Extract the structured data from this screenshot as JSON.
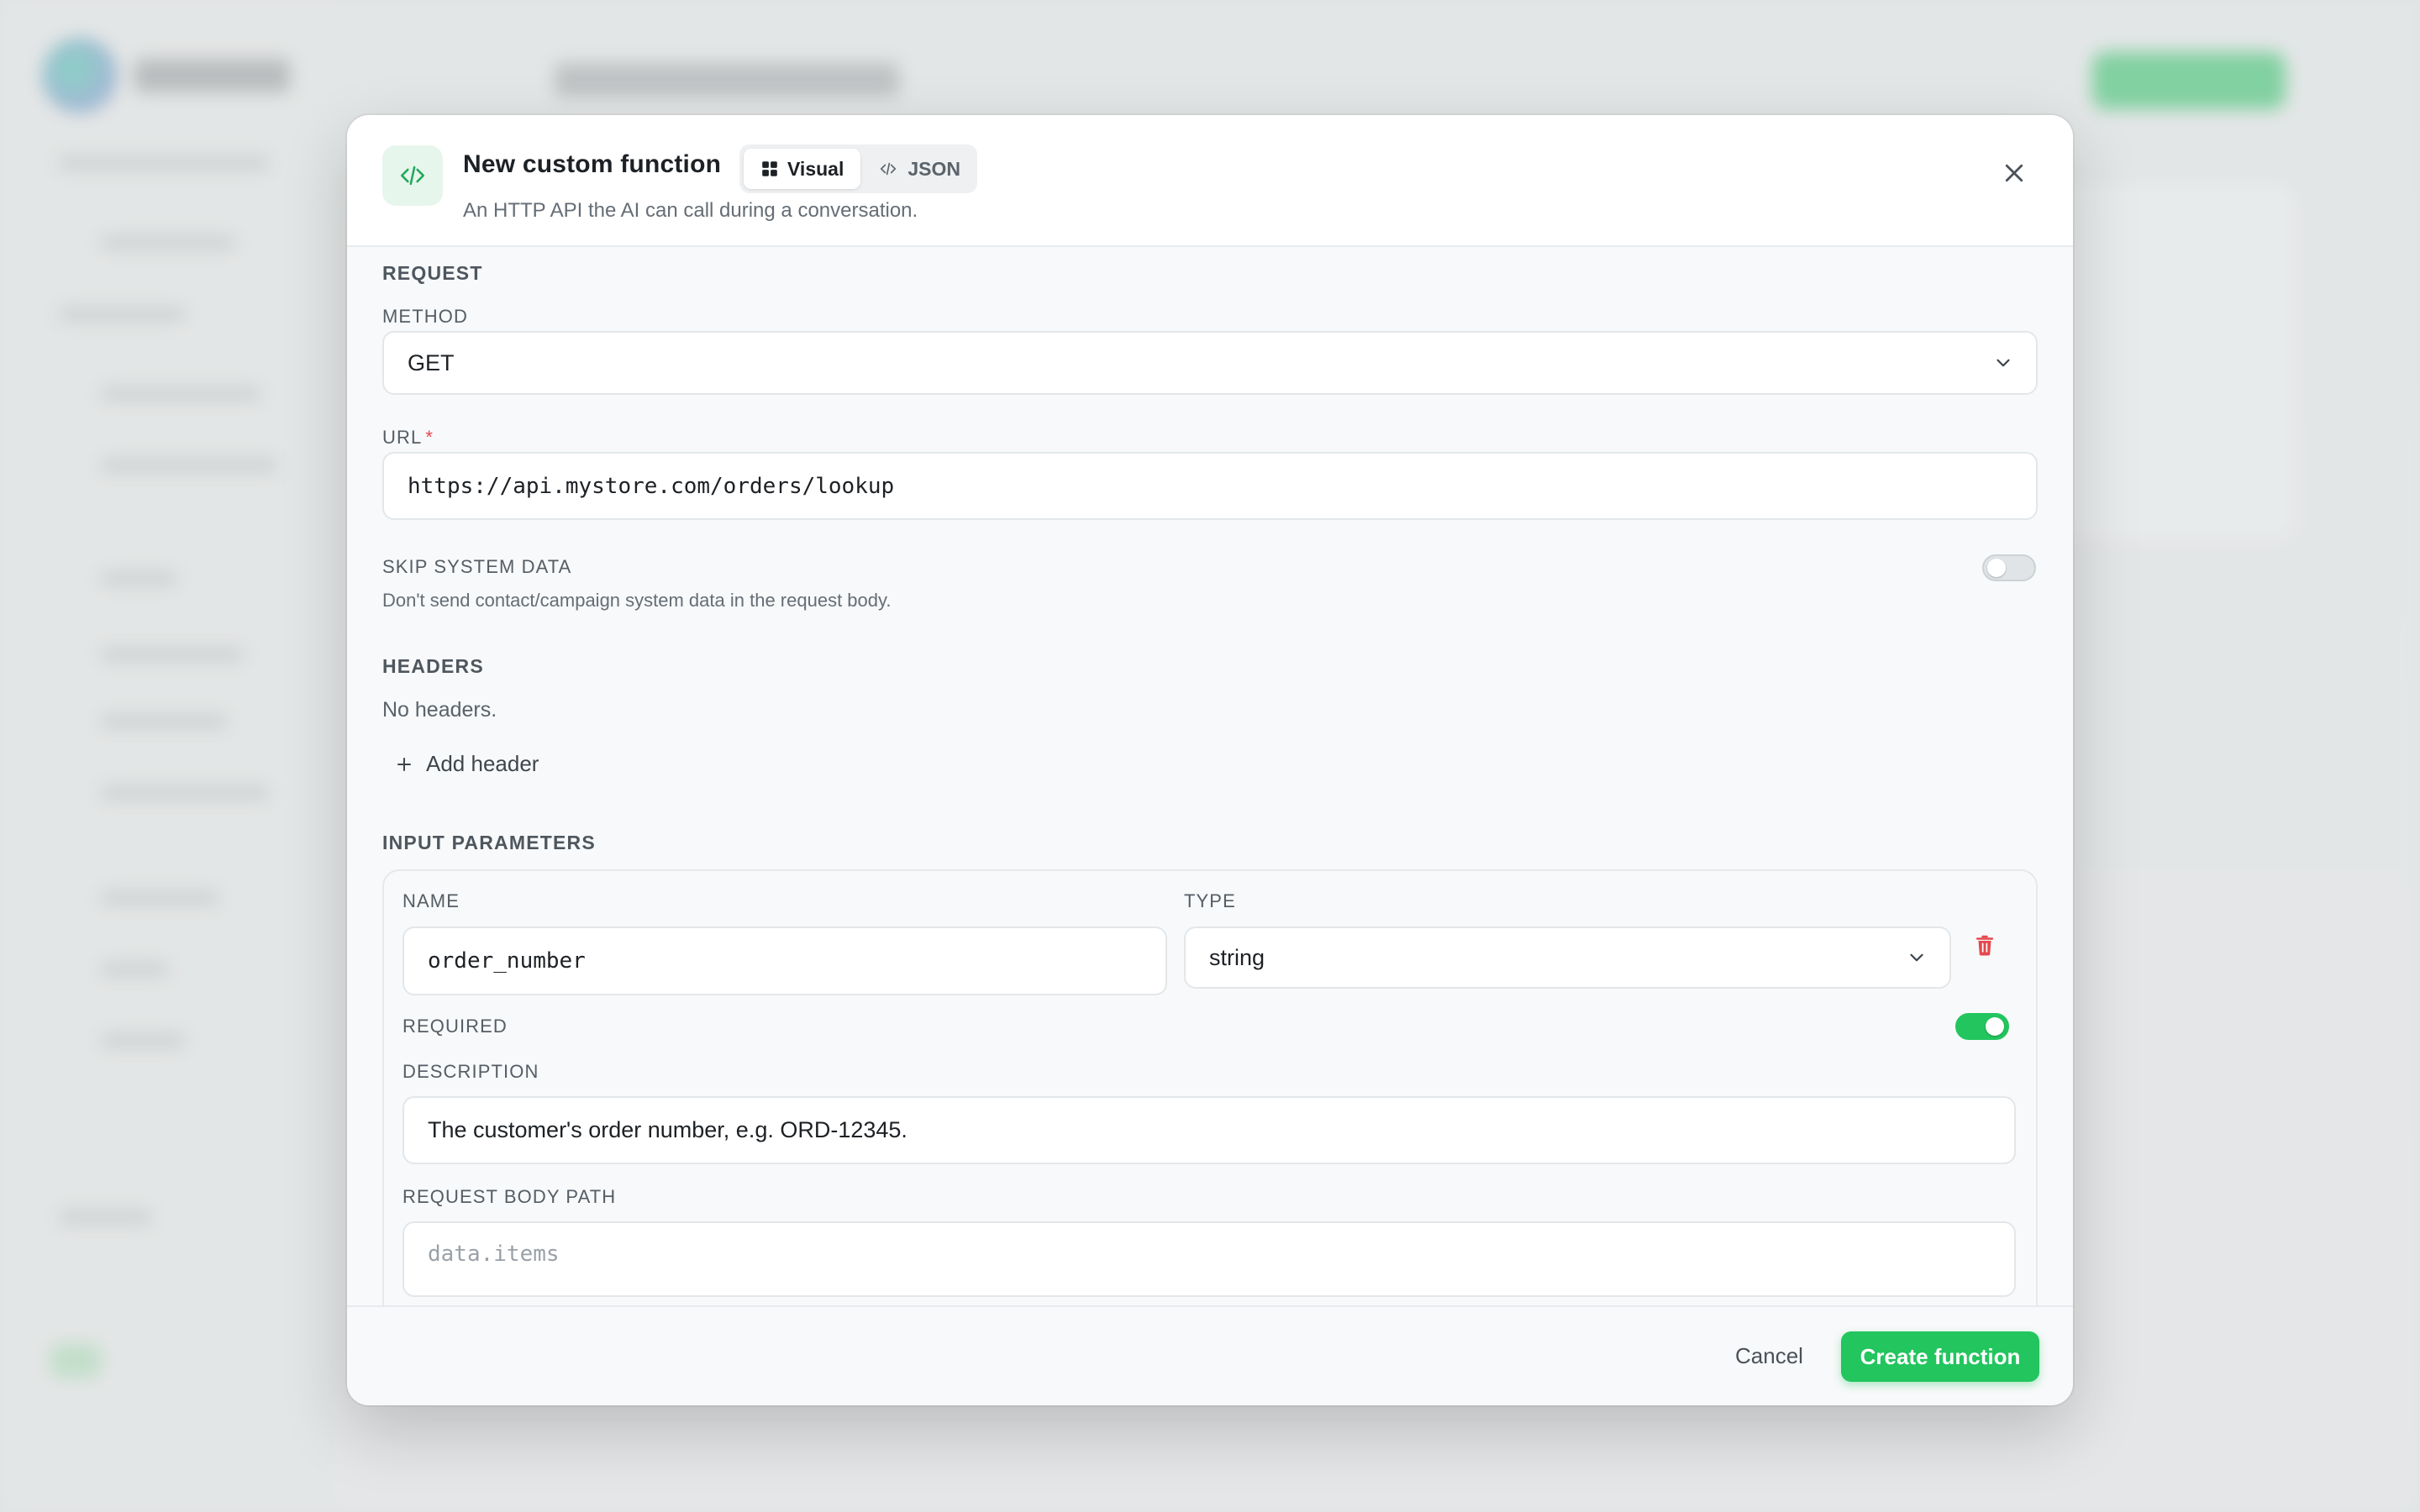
{
  "modal": {
    "title": "New custom function",
    "subtitle": "An HTTP API the AI can call during a conversation.",
    "mode_tabs": [
      {
        "label": "Visual",
        "active": true,
        "icon": "grid-icon"
      },
      {
        "label": "JSON",
        "active": false,
        "icon": "code-icon"
      }
    ]
  },
  "request": {
    "section_title": "REQUEST",
    "method_label": "METHOD",
    "method_value": "GET",
    "url_label": "URL",
    "url_required_mark": "*",
    "url_value": "https://api.mystore.com/orders/lookup",
    "skip_label": "SKIP SYSTEM DATA",
    "skip_enabled": false,
    "skip_help": "Don't send contact/campaign system data in the request body."
  },
  "headers": {
    "section_title": "HEADERS",
    "empty_text": "No headers.",
    "add_label": "Add header"
  },
  "params": {
    "section_title": "INPUT PARAMETERS",
    "items": [
      {
        "name_label": "NAME",
        "name_value": "order_number",
        "type_label": "TYPE",
        "type_value": "string",
        "required_label": "REQUIRED",
        "required": true,
        "description_label": "DESCRIPTION",
        "description_value": "The customer's order number, e.g. ORD-12345.",
        "body_path_label": "REQUEST BODY PATH",
        "body_path_placeholder": "data.items"
      }
    ]
  },
  "footer": {
    "cancel_label": "Cancel",
    "submit_label": "Create function"
  },
  "colors": {
    "accent": "#22c55e",
    "danger": "#e5484d"
  }
}
